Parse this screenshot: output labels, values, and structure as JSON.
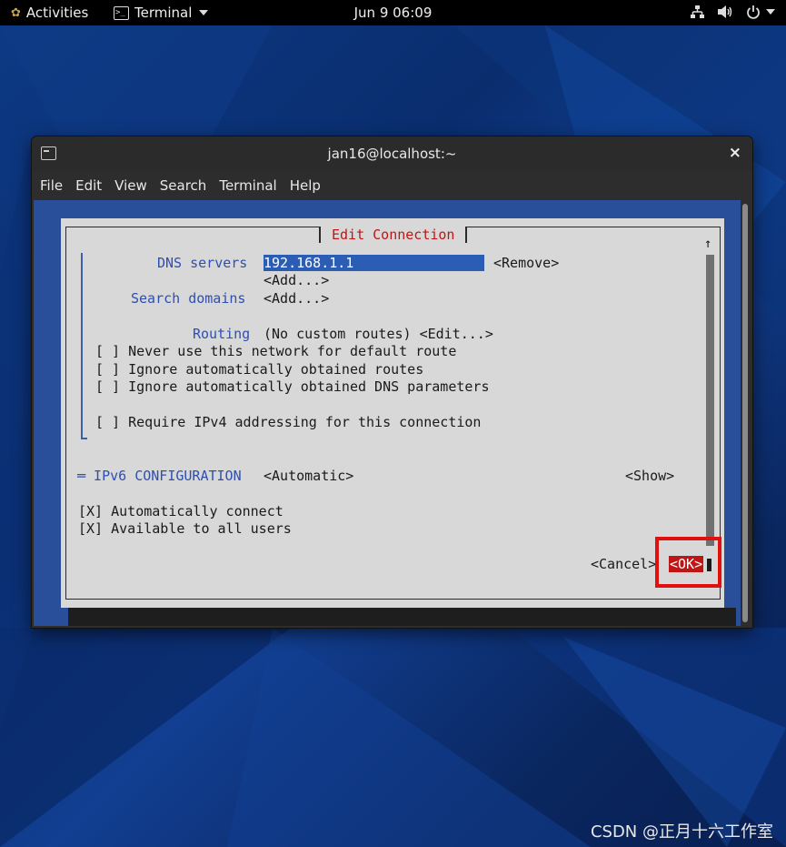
{
  "topbar": {
    "activities": "Activities",
    "app_menu": "Terminal",
    "clock": "Jun 9  06:09"
  },
  "window": {
    "title": "jan16@localhost:~",
    "close": "×",
    "menu": [
      "File",
      "Edit",
      "View",
      "Search",
      "Terminal",
      "Help"
    ]
  },
  "dialog": {
    "title": "Edit Connection",
    "dns_label": "DNS servers",
    "dns_value": "192.168.1.1",
    "remove": "<Remove>",
    "add_dns": "<Add...>",
    "search_label": "Search domains",
    "add_search": "<Add...>",
    "routing_label": "Routing",
    "routing_value": "(No custom routes) <Edit...>",
    "opt1": "[ ] Never use this network for default route",
    "opt2": "[ ] Ignore automatically obtained routes",
    "opt3": "[ ] Ignore automatically obtained DNS parameters",
    "opt4": "[ ] Require IPv4 addressing for this connection",
    "ipv6_label": "═ IPv6 CONFIGURATION",
    "ipv6_value": "<Automatic>",
    "show": "<Show>",
    "auto_connect": "[X] Automatically connect",
    "all_users": "[X] Available to all users",
    "cancel": "<Cancel>",
    "ok": "<OK>",
    "scroll_up": "↑"
  },
  "watermark": "CSDN @正月十六工作室",
  "colors": {
    "dialog_bg": "#d8d8d8",
    "title_red": "#c01515",
    "label_blue": "#2e4fb0",
    "terminal_blue": "#2a4f9a",
    "highlight_box": "#e01010"
  }
}
